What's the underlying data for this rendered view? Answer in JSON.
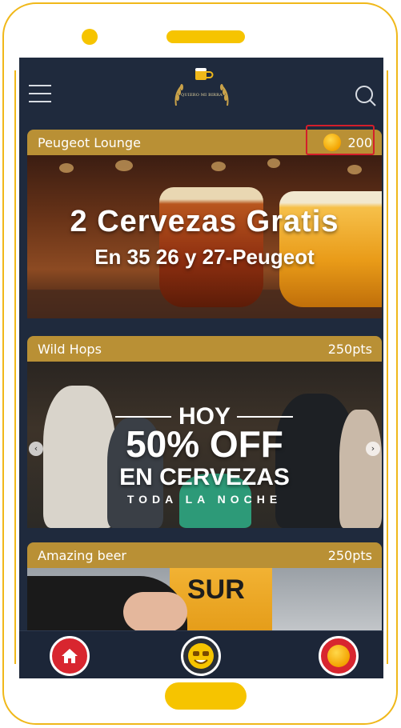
{
  "app": {
    "logo_text": "QUIERO MI BIRRA"
  },
  "cards": [
    {
      "name": "Peugeot Lounge",
      "points": "200",
      "promo_line1": "2 Cervezas Gratis",
      "promo_line2": "En 35 26 y 27-Peugeot"
    },
    {
      "name": "Wild Hops",
      "points": "250pts",
      "promo_hoy": "HOY",
      "promo_big": "50% OFF",
      "promo_mid": "EN CERVEZAS",
      "promo_small": "TODA LA NOCHE"
    },
    {
      "name": "Amazing beer",
      "points": "250pts",
      "image_text": "SUR"
    }
  ],
  "colors": {
    "accent": "#b99035",
    "screen_bg": "#1f2a3d",
    "frame": "#f0b81a",
    "highlight": "#d41e2b"
  },
  "icons": {
    "menu": "hamburger-icon",
    "search": "search-icon",
    "home": "home-icon",
    "emoji": "emoji-icon",
    "coin": "coin-icon"
  }
}
